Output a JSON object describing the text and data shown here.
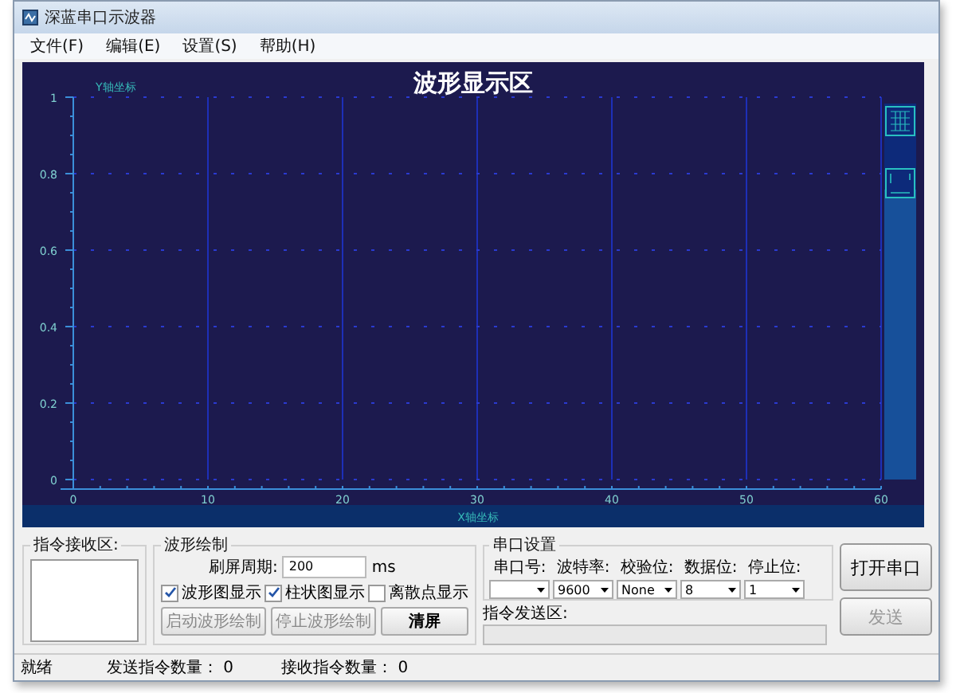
{
  "window": {
    "title": "深蓝串口示波器"
  },
  "menu": [
    {
      "label": "文件(F)"
    },
    {
      "label": "编辑(E)"
    },
    {
      "label": "设置(S)"
    },
    {
      "label": "帮助(H)"
    }
  ],
  "waveform": {
    "chart_data": {
      "type": "line",
      "title": "波形显示区",
      "xlabel": "X轴坐标",
      "ylabel": "Y轴坐标",
      "xlim": [
        0,
        60
      ],
      "ylim": [
        0,
        1
      ],
      "xticks": [
        0,
        10,
        20,
        30,
        40,
        50,
        60
      ],
      "yticks": [
        0,
        0.2,
        0.4,
        0.6,
        0.8,
        1
      ],
      "grid": true
    }
  },
  "receive": {
    "legend": "指令接收区:"
  },
  "drawing": {
    "legend": "波形绘制",
    "period_label": "刷屏周期:",
    "period_value": "200",
    "period_unit": "ms",
    "checks": [
      {
        "label": "波形图显示",
        "checked": true
      },
      {
        "label": "柱状图显示",
        "checked": true
      },
      {
        "label": "离散点显示",
        "checked": false
      }
    ],
    "buttons": [
      {
        "label": "启动波形绘制",
        "disabled": true
      },
      {
        "label": "停止波形绘制",
        "disabled": true
      },
      {
        "label": "清屏",
        "disabled": false
      }
    ]
  },
  "serial": {
    "legend": "串口设置",
    "fields": [
      {
        "label": "串口号:"
      },
      {
        "label": "波特率:",
        "value": "9600"
      },
      {
        "label": "校验位:",
        "value": "None"
      },
      {
        "label": "数据位:",
        "value": "8"
      },
      {
        "label": "停止位:",
        "value": "1"
      }
    ]
  },
  "send": {
    "legend": "指令发送区:",
    "disabled": true
  },
  "actions": [
    {
      "label": "打开串口",
      "disabled": false
    },
    {
      "label": "发送",
      "disabled": true
    }
  ],
  "status_bar": {
    "state": "就绪",
    "sent_label": "发送指令数量：",
    "sent": "0",
    "received_label": "接收指令数量：",
    "received": "0"
  }
}
